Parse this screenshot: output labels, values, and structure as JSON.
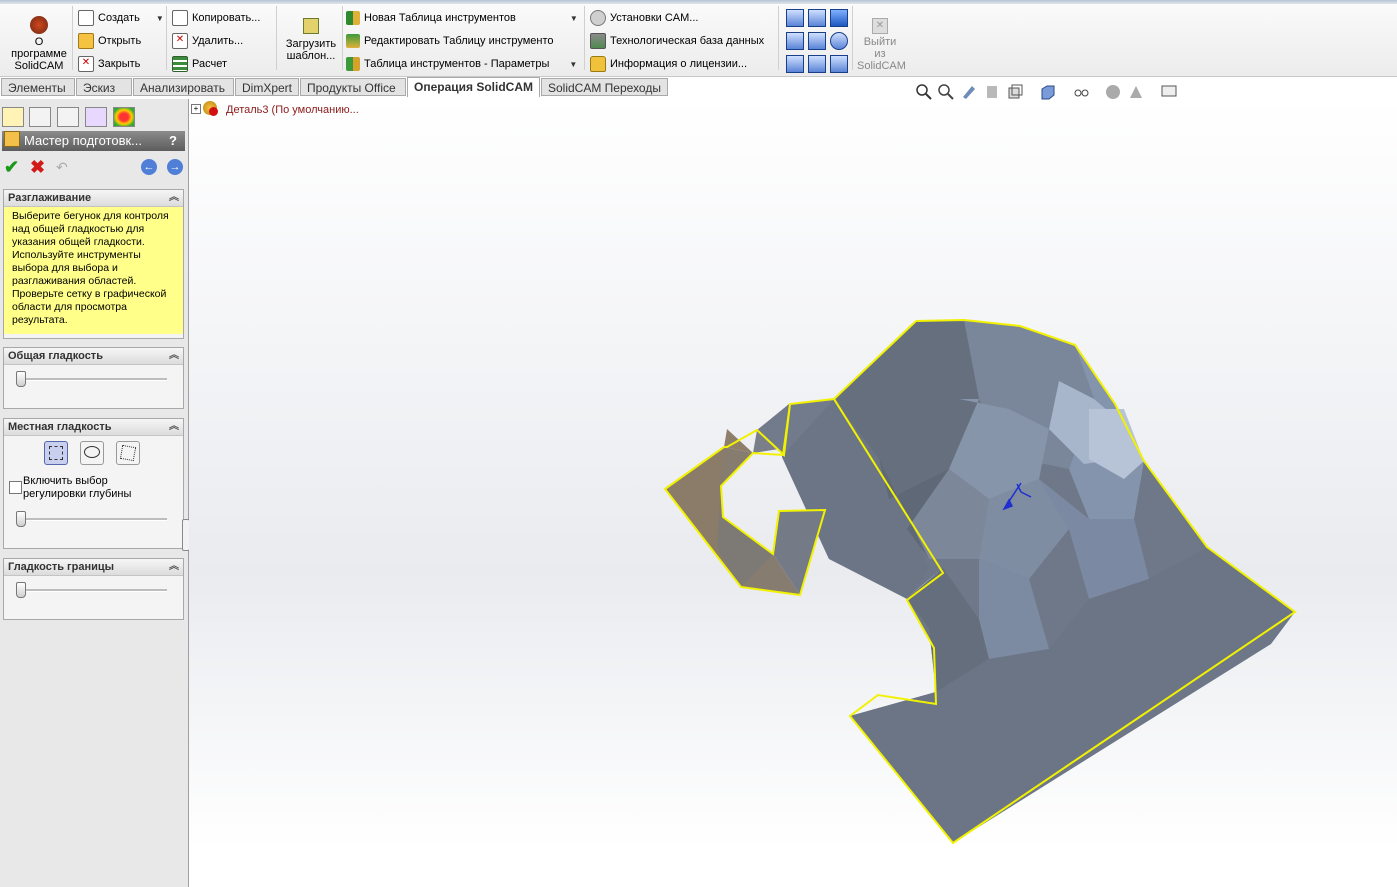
{
  "ribbon": {
    "about": "О программе SolidCAM",
    "create": "Создать",
    "open": "Открыть",
    "close": "Закрыть",
    "copy": "Копировать...",
    "delete": "Удалить...",
    "calc": "Расчет",
    "load_template": "Загрузить шаблон...",
    "new_tool_table": "Новая Таблица инструментов",
    "edit_tool_table": "Редактировать Таблицу инструменто",
    "tool_table_params": "Таблица инструментов - Параметры",
    "cam_settings": "Установки CAM...",
    "tech_db": "Технологическая база данных",
    "license_info": "Информация о лицензии...",
    "exit": "Выйти из SolidCAM"
  },
  "tabs": [
    "Элементы",
    "Эскиз",
    "Анализировать",
    "DimXpert",
    "Продукты Office",
    "Операция  SolidCAM",
    "SolidCAM Переходы"
  ],
  "active_tab": "Операция  SolidCAM",
  "panel": {
    "title": "Мастер подготовк...",
    "help": "?",
    "smoothing": {
      "header": "Разглаживание",
      "message": "Выберите бегунок для контроля над общей гладкостью для указания общей гладкости. Используйте инструменты выбора для выбора и разглаживания областей. Проверьте сетку в графической области для просмотра результата."
    },
    "global_smooth": {
      "header": "Общая гладкость",
      "value": 0
    },
    "local_smooth": {
      "header": "Местная гладкость",
      "checkbox_label": "Включить выбор регулировки глубины",
      "checked": false,
      "value": 0
    },
    "border_smooth": {
      "header": "Гладкость границы",
      "value": 0
    }
  },
  "tree": {
    "item": "Деталь3  (По умолчанию..."
  },
  "colors": {
    "mesh_dark": "#6c7585",
    "mesh_mid": "#7b879b",
    "mesh_light": "#a9b6cc",
    "outline": "#f2f200",
    "tan": "#8a7c69",
    "note_bg": "#ffff8a"
  }
}
